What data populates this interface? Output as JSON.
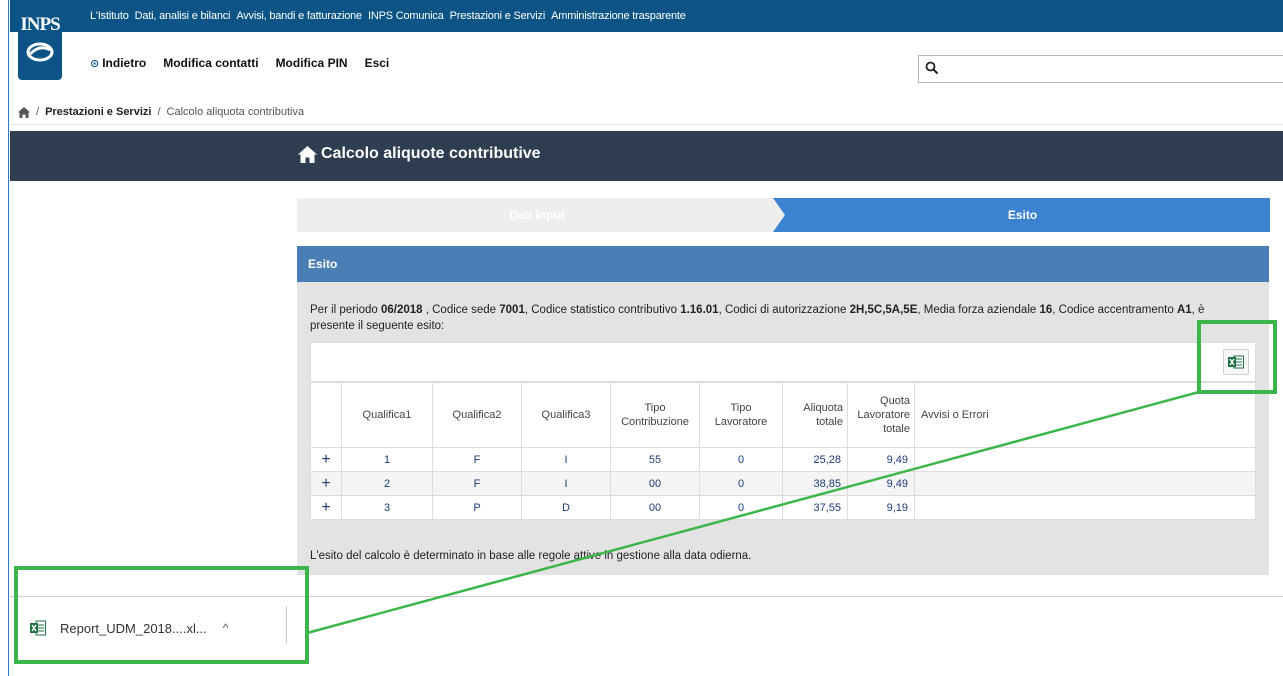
{
  "header": {
    "logo_text": "INPS",
    "top_links": [
      "L'Istituto",
      "Dati, analisi e bilanci",
      "Avvisi, bandi e fatturazione",
      "INPS Comunica",
      "Prestazioni e Servizi",
      "Amministrazione trasparente"
    ],
    "nav": {
      "back": "Indietro",
      "edit_contacts": "Modifica contatti",
      "edit_pin": "Modifica PIN",
      "logout": "Esci"
    },
    "search": {
      "placeholder": "",
      "icon": "search-icon"
    }
  },
  "breadcrumb": {
    "home_icon": "home-icon",
    "items": [
      "Prestazioni e Servizi",
      "Calcolo aliquota contributiva"
    ]
  },
  "page_title": "Calcolo aliquote contributive",
  "stepper": {
    "steps": [
      "Dati input",
      "Esito"
    ],
    "active_index": 1
  },
  "panel": {
    "title": "Esito",
    "description": {
      "p1": "Per il periodo ",
      "periodo": "06/2018",
      "p2": " , Codice sede ",
      "codice_sede": "7001",
      "p3": ", Codice statistico contributivo ",
      "csc": "1.16.01",
      "p4": ", Codici di autorizzazione ",
      "codici_autorizzazione": "2H,5C,5A,5E",
      "p5": ", Media forza aziendale ",
      "media_forza": "16",
      "p6": ", Codice accentramento ",
      "codice_accentramento": "A1",
      "p7": ", è presente il seguente esito:"
    },
    "export_icon": "excel-icon",
    "table": {
      "columns": [
        [
          "Qualifica1"
        ],
        [
          "Qualifica2"
        ],
        [
          "Qualifica3"
        ],
        [
          "Tipo",
          "Contribuzione"
        ],
        [
          "Tipo",
          "Lavoratore"
        ],
        [
          "Aliquota",
          "totale"
        ],
        [
          "Quota",
          "Lavoratore",
          "totale"
        ],
        [
          "Avvisi o Errori"
        ]
      ],
      "rows": [
        {
          "expand": "+",
          "q1": "1",
          "q2": "F",
          "q3": "I",
          "tipo_contribuzione": "55",
          "tipo_lavoratore": "0",
          "aliquota_totale": "25,28",
          "quota_lavoratore": "9,49",
          "avvisi": ""
        },
        {
          "expand": "+",
          "q1": "2",
          "q2": "F",
          "q3": "I",
          "tipo_contribuzione": "00",
          "tipo_lavoratore": "0",
          "aliquota_totale": "38,85",
          "quota_lavoratore": "9,49",
          "avvisi": ""
        },
        {
          "expand": "+",
          "q1": "3",
          "q2": "P",
          "q3": "D",
          "tipo_contribuzione": "00",
          "tipo_lavoratore": "0",
          "aliquota_totale": "37,55",
          "quota_lavoratore": "9,19",
          "avvisi": ""
        }
      ]
    },
    "footnote": "L'esito del calcolo è determinato in base alle regole attive in gestione alla data odierna."
  },
  "download_bar": {
    "file_name": "Report_UDM_2018....xl...",
    "file_icon": "excel-file-icon",
    "chevron": "^"
  },
  "colors": {
    "top_bar": "#0b5485",
    "title_bar": "#2e3d4f",
    "step_active": "#3b82d0",
    "panel_header": "#4a7fb5",
    "annotation": "#3cb54a"
  }
}
